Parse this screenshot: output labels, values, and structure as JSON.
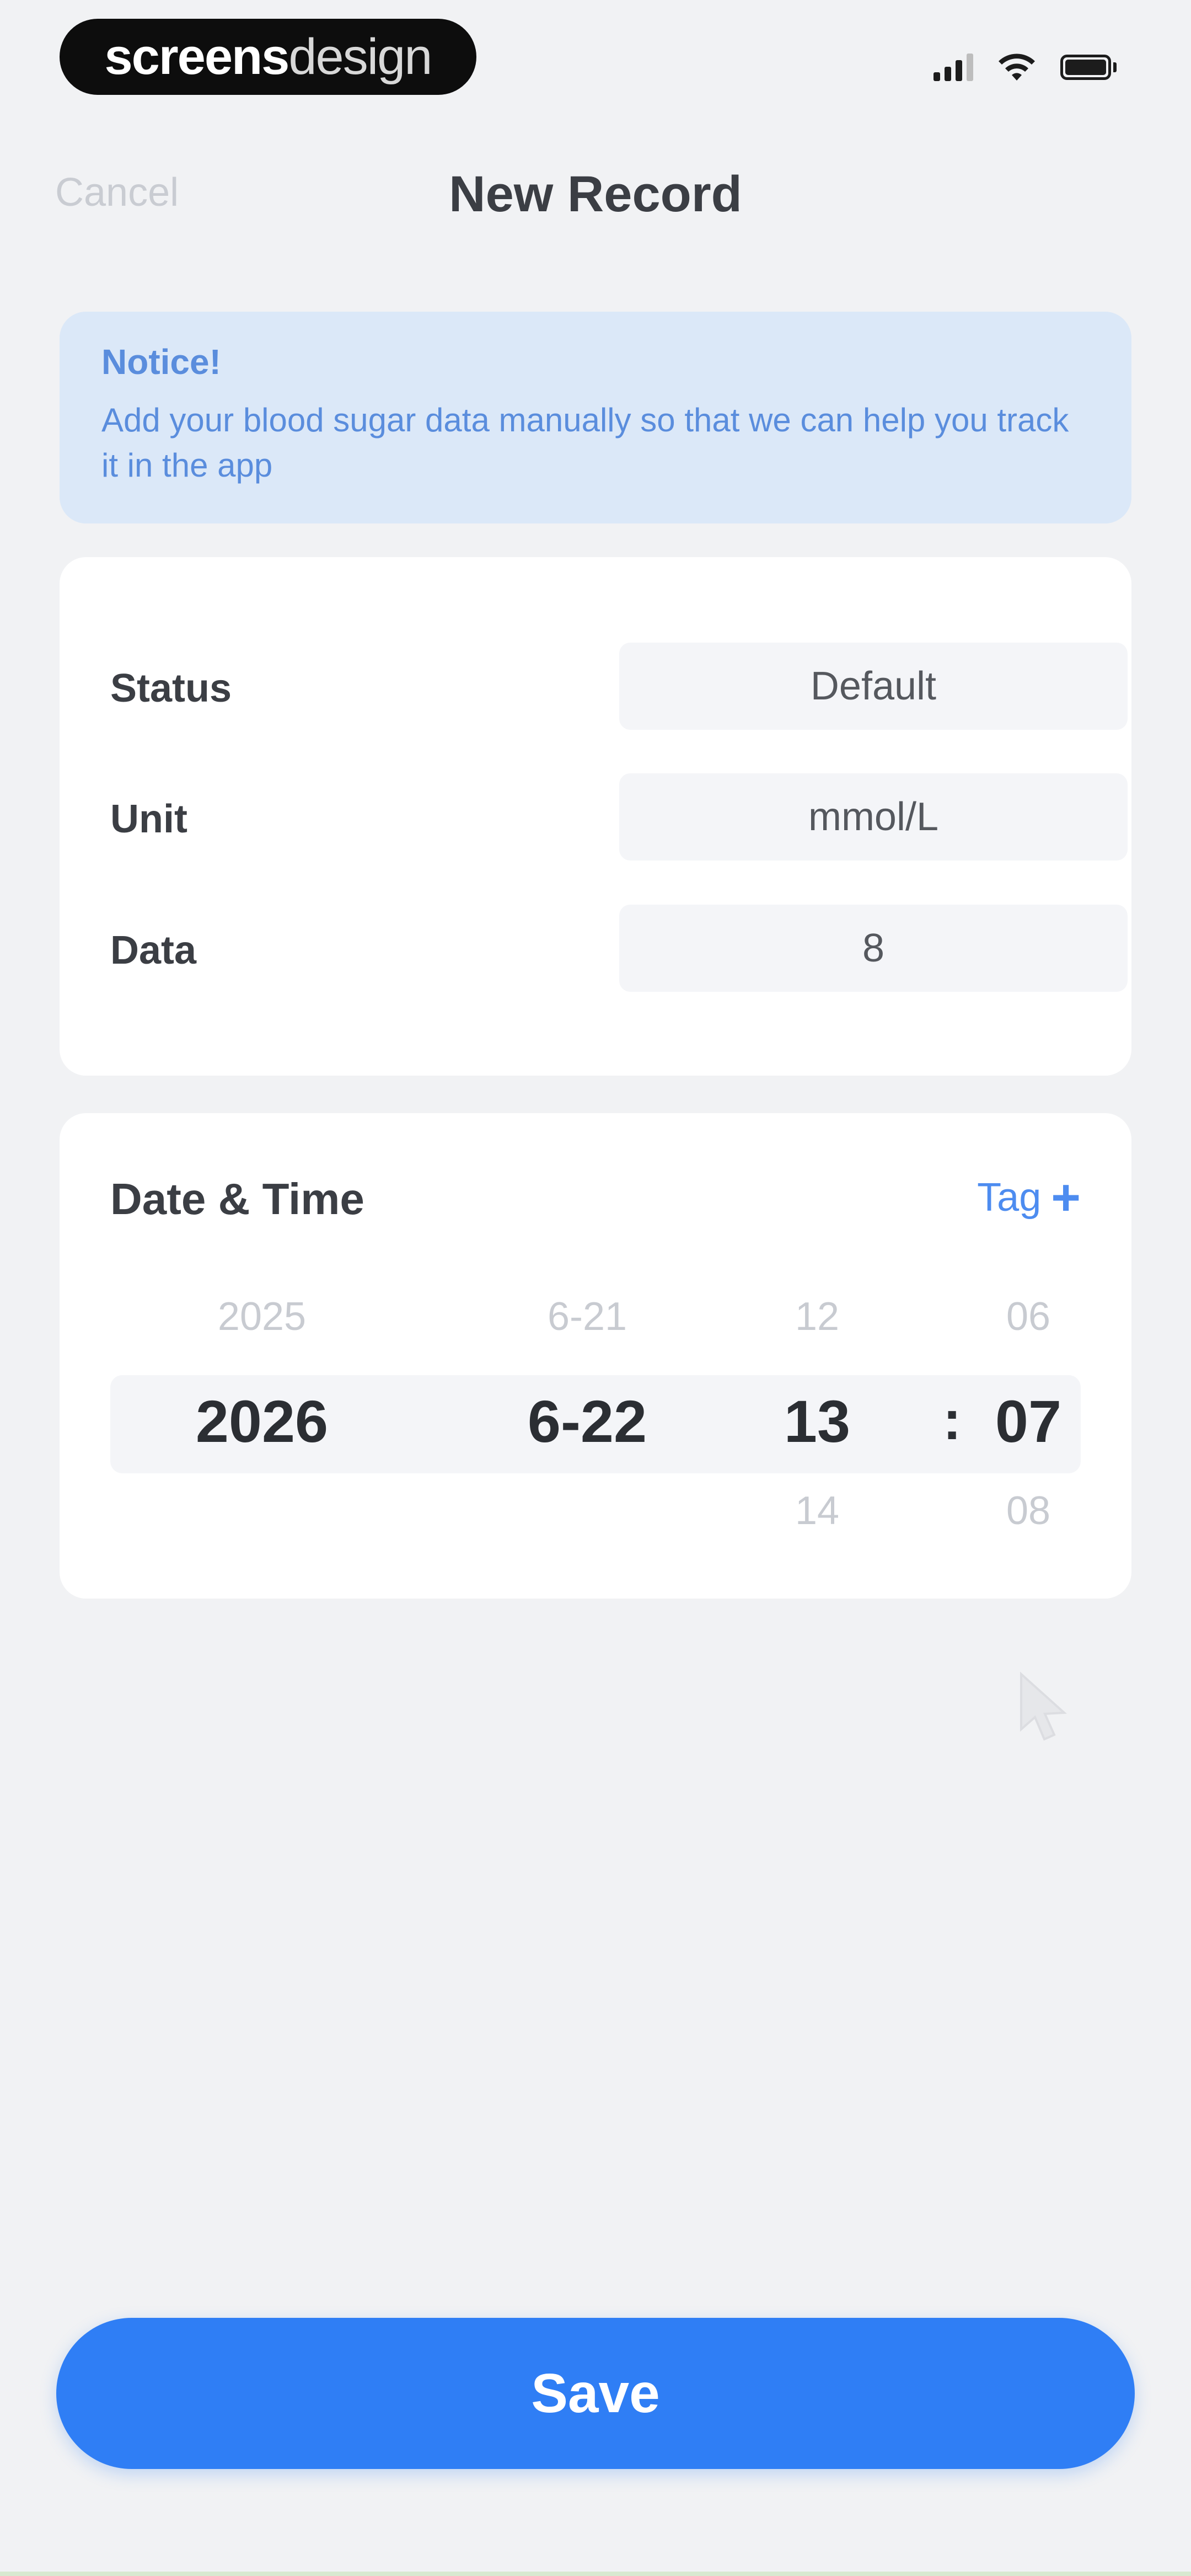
{
  "status_bar": {
    "brand_bold": "screens",
    "brand_light": "design"
  },
  "nav": {
    "cancel_label": "Cancel",
    "title": "New Record"
  },
  "notice": {
    "title": "Notice!",
    "text": "Add your blood sugar data manually so that we can help you track it in the app"
  },
  "form": {
    "status_label": "Status",
    "status_value": "Default",
    "unit_label": "Unit",
    "unit_value": "mmol/L",
    "data_label": "Data",
    "data_value": "8"
  },
  "date_time": {
    "title": "Date & Time",
    "tag_label": "Tag",
    "tag_icon": "plus-icon",
    "year": {
      "prev": "2025",
      "current": "2026",
      "next": ""
    },
    "date": {
      "prev": "6-21",
      "current": "6-22",
      "next": ""
    },
    "hour": {
      "prev": "12",
      "current": "13",
      "next": "14"
    },
    "minute": {
      "prev": "06",
      "current": "07",
      "next": "08"
    },
    "separator": ":"
  },
  "save_label": "Save",
  "colors": {
    "accent": "#2f7ef5",
    "notice_bg": "#dbe8f8",
    "notice_text": "#5a8ddd",
    "background": "#f1f2f4"
  }
}
